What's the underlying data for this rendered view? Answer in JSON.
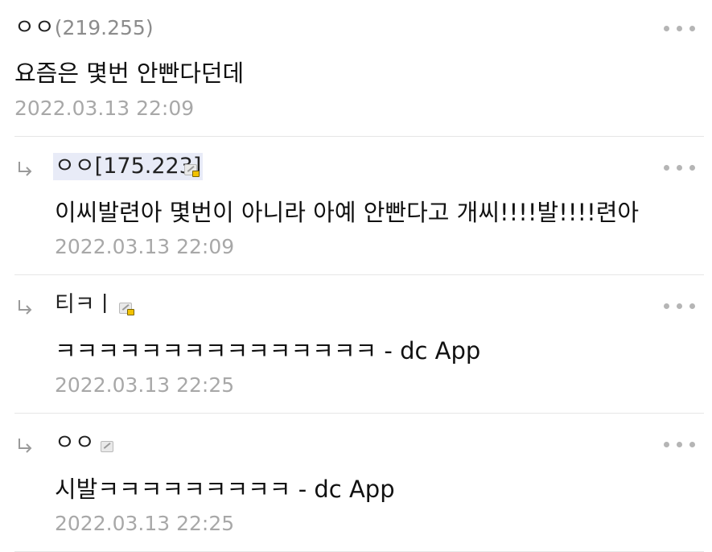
{
  "comments": [
    {
      "nick": "ㅇㅇ",
      "ip": "(219.255)",
      "text": "요즘은 몇번 안빤다던데",
      "date": "2022.03.13 22:09"
    }
  ],
  "replies": [
    {
      "nick": "ㅇㅇ[175.223]",
      "text": "이씨발련아 몇번이 아니라 아예 안빤다고 개씨!!!!발!!!!련아",
      "date": "2022.03.13 22:09",
      "badge_icon": "fixed-nick-lock-icon"
    },
    {
      "nick": "티ㅋㅣ",
      "text": "ㅋㅋㅋㅋㅋㅋㅋㅋㅋㅋㅋㅋㅋㅋㅋ - dc App",
      "date": "2022.03.13 22:25",
      "badge_icon": "fixed-nick-lock-icon"
    },
    {
      "nick": "ㅇㅇ",
      "text": "시발ㅋㅋㅋㅋㅋㅋㅋㅋㅋ - dc App",
      "date": "2022.03.13 22:25",
      "badge_icon": "semi-fixed-nick-icon"
    }
  ],
  "icons": {
    "more": "more-options-icon",
    "reply": "reply-arrow-icon"
  },
  "colors": {
    "ip": "#8c8c8c",
    "date": "#a8a8a8",
    "nick_highlight": "#e8ebf7"
  }
}
